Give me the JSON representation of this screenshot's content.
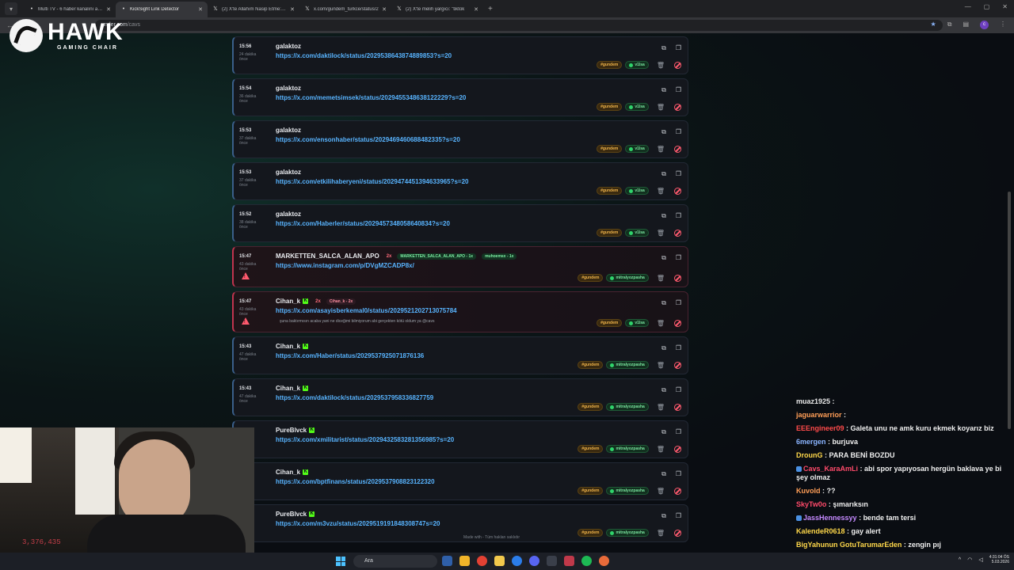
{
  "browser": {
    "tabs": [
      {
        "label": "Multi TV - 6 haber kanalını aynı",
        "active": false
      },
      {
        "label": "KickSight Link Detector",
        "active": true
      },
      {
        "label": "(2) X'te Allahım Nasip Etme: \"G",
        "active": false
      },
      {
        "label": "x.com/gundem_turkce/status/2",
        "active": false
      },
      {
        "label": "(2) X'te melih yargıcı: \"tiktok",
        "active": false
      }
    ],
    "url_host": "under.com",
    "url_path": "/cavs"
  },
  "logo": {
    "brand": "HAWK",
    "sub": "GAMING CHAIR"
  },
  "cards": [
    {
      "time": "15:56",
      "ago": "24 dakika önce",
      "user": "galaktoz",
      "kick": false,
      "count": "",
      "chips": [],
      "link": "https://x.com/daktilock/status/2029538643874889853?s=20",
      "snippet": "",
      "tag": "#gundem",
      "status": "v1lsa",
      "alert": false
    },
    {
      "time": "15:54",
      "ago": "36 dakika önce",
      "user": "galaktoz",
      "kick": false,
      "count": "",
      "chips": [],
      "link": "https://x.com/memetsimsek/status/2029455348638122229?s=20",
      "snippet": "",
      "tag": "#gundem",
      "status": "v1lsa",
      "alert": false
    },
    {
      "time": "15:53",
      "ago": "37 dakika önce",
      "user": "galaktoz",
      "kick": false,
      "count": "",
      "chips": [],
      "link": "https://x.com/ensonhaber/status/2029469460688482335?s=20",
      "snippet": "",
      "tag": "#gundem",
      "status": "v1lsa",
      "alert": false
    },
    {
      "time": "15:53",
      "ago": "37 dakika önce",
      "user": "galaktoz",
      "kick": false,
      "count": "",
      "chips": [],
      "link": "https://x.com/etkilihaberyeni/status/2029474451394633965?s=20",
      "snippet": "",
      "tag": "#gundem",
      "status": "v1lsa",
      "alert": false
    },
    {
      "time": "15:52",
      "ago": "38 dakika önce",
      "user": "galaktoz",
      "kick": false,
      "count": "",
      "chips": [],
      "link": "https://x.com/Haberler/status/2029457348058640834?s=20",
      "snippet": "",
      "tag": "#gundem",
      "status": "v1lsa",
      "alert": false
    },
    {
      "time": "15:47",
      "ago": "43 dakika önce",
      "user": "MARKETTEN_SALCA_ALAN_APO",
      "kick": false,
      "count": "2x",
      "chips": [
        {
          "text": "MARKETTEN_SALCA_ALAN_APO - 1x",
          "kind": "green"
        },
        {
          "text": "muhoemsx - 1x",
          "kind": "green"
        }
      ],
      "link": "https://www.instagram.com/p/DVgMZCADP8x/",
      "snippet": "",
      "tag": "#gundem",
      "status": "mitralyozpasha",
      "alert": true
    },
    {
      "time": "15:47",
      "ago": "43 dakika önce",
      "user": "Cihan_k",
      "kick": true,
      "count": "2x",
      "chips": [
        {
          "text": "Cihan_k - 2x",
          "kind": "pink"
        }
      ],
      "link": "https://x.com/asayisberkemal0/status/2029521202713075784",
      "snippet": "şuna baktırmısın acaba yani ne diceğimi bilmiyorum abi gerçekten kötü oldum ya @cavs",
      "tag": "#gundem",
      "status": "v1lsa",
      "alert": true
    },
    {
      "time": "15:43",
      "ago": "47 dakika önce",
      "user": "Cihan_k",
      "kick": true,
      "count": "",
      "chips": [],
      "link": "https://x.com/Haber/status/2029537925071876136",
      "snippet": "",
      "tag": "#gundem",
      "status": "mitralyozpasha",
      "alert": false
    },
    {
      "time": "15:43",
      "ago": "47 dakika önce",
      "user": "Cihan_k",
      "kick": true,
      "count": "",
      "chips": [],
      "link": "https://x.com/daktilock/status/2029537958336827759",
      "snippet": "",
      "tag": "#gundem",
      "status": "mitralyozpasha",
      "alert": false
    },
    {
      "time": "",
      "ago": "",
      "user": "PureBlvck",
      "kick": true,
      "count": "",
      "chips": [],
      "link": "https://x.com/xmilitarist/status/2029432583281356985?s=20",
      "snippet": "",
      "tag": "#gundem",
      "status": "mitralyozpasha",
      "alert": false
    },
    {
      "time": "",
      "ago": "",
      "user": "Cihan_k",
      "kick": true,
      "count": "",
      "chips": [],
      "link": "https://x.com/bptfinans/status/2029537908823122320",
      "snippet": "",
      "tag": "#gundem",
      "status": "mitralyozpasha",
      "alert": false
    },
    {
      "time": "",
      "ago": "",
      "user": "PureBlvck",
      "kick": true,
      "count": "",
      "chips": [],
      "link": "https://x.com/m3vzu/status/2029519191848308747s=20",
      "snippet": "",
      "tag": "#gundem",
      "status": "mitralyozpasha",
      "alert": false
    }
  ],
  "footer": "Made with  - Tüm hakları saklıdır",
  "webcam": {
    "counter": "3,376,435"
  },
  "chat": [
    {
      "name": "muaz1925",
      "color": "#e8e8e8",
      "text": "",
      "badge": false
    },
    {
      "name": "jaguarwarrior",
      "color": "#ff9e57",
      "text": "",
      "badge": false
    },
    {
      "name": "EEEngineer09",
      "color": "#ff4a4a",
      "text": "Galeta unu ne amk kuru ekmek koyarız biz",
      "badge": false
    },
    {
      "name": "6mergen",
      "color": "#8ab4ff",
      "text": "burjuva",
      "badge": false
    },
    {
      "name": "DrounG",
      "color": "#ffd84a",
      "text": "PARA BENİ BOZDU",
      "badge": false
    },
    {
      "name": "Cavs_KaraAmLi",
      "color": "#ff4a6a",
      "text": "abi spor yapıyosan hergün baklava ye bi şey olmaz",
      "badge": true
    },
    {
      "name": "Kuvold",
      "color": "#ff9e57",
      "text": "??",
      "badge": false
    },
    {
      "name": "SkyTw0o",
      "color": "#ff4a6a",
      "text": "şımarıksın",
      "badge": false
    },
    {
      "name": "JassHennessyy",
      "color": "#c58aff",
      "text": "bende tam tersi",
      "badge": true
    },
    {
      "name": "KalendeR0618",
      "color": "#ffd84a",
      "text": "gay alert",
      "badge": false
    },
    {
      "name": "BigYahunun GotuTarumarEden",
      "color": "#ffd84a",
      "text": "zengin pıj",
      "badge": false
    }
  ],
  "taskbar": {
    "search_placeholder": "Ara",
    "time": "4:31:04 ÖS",
    "date": "5.03.2026"
  }
}
